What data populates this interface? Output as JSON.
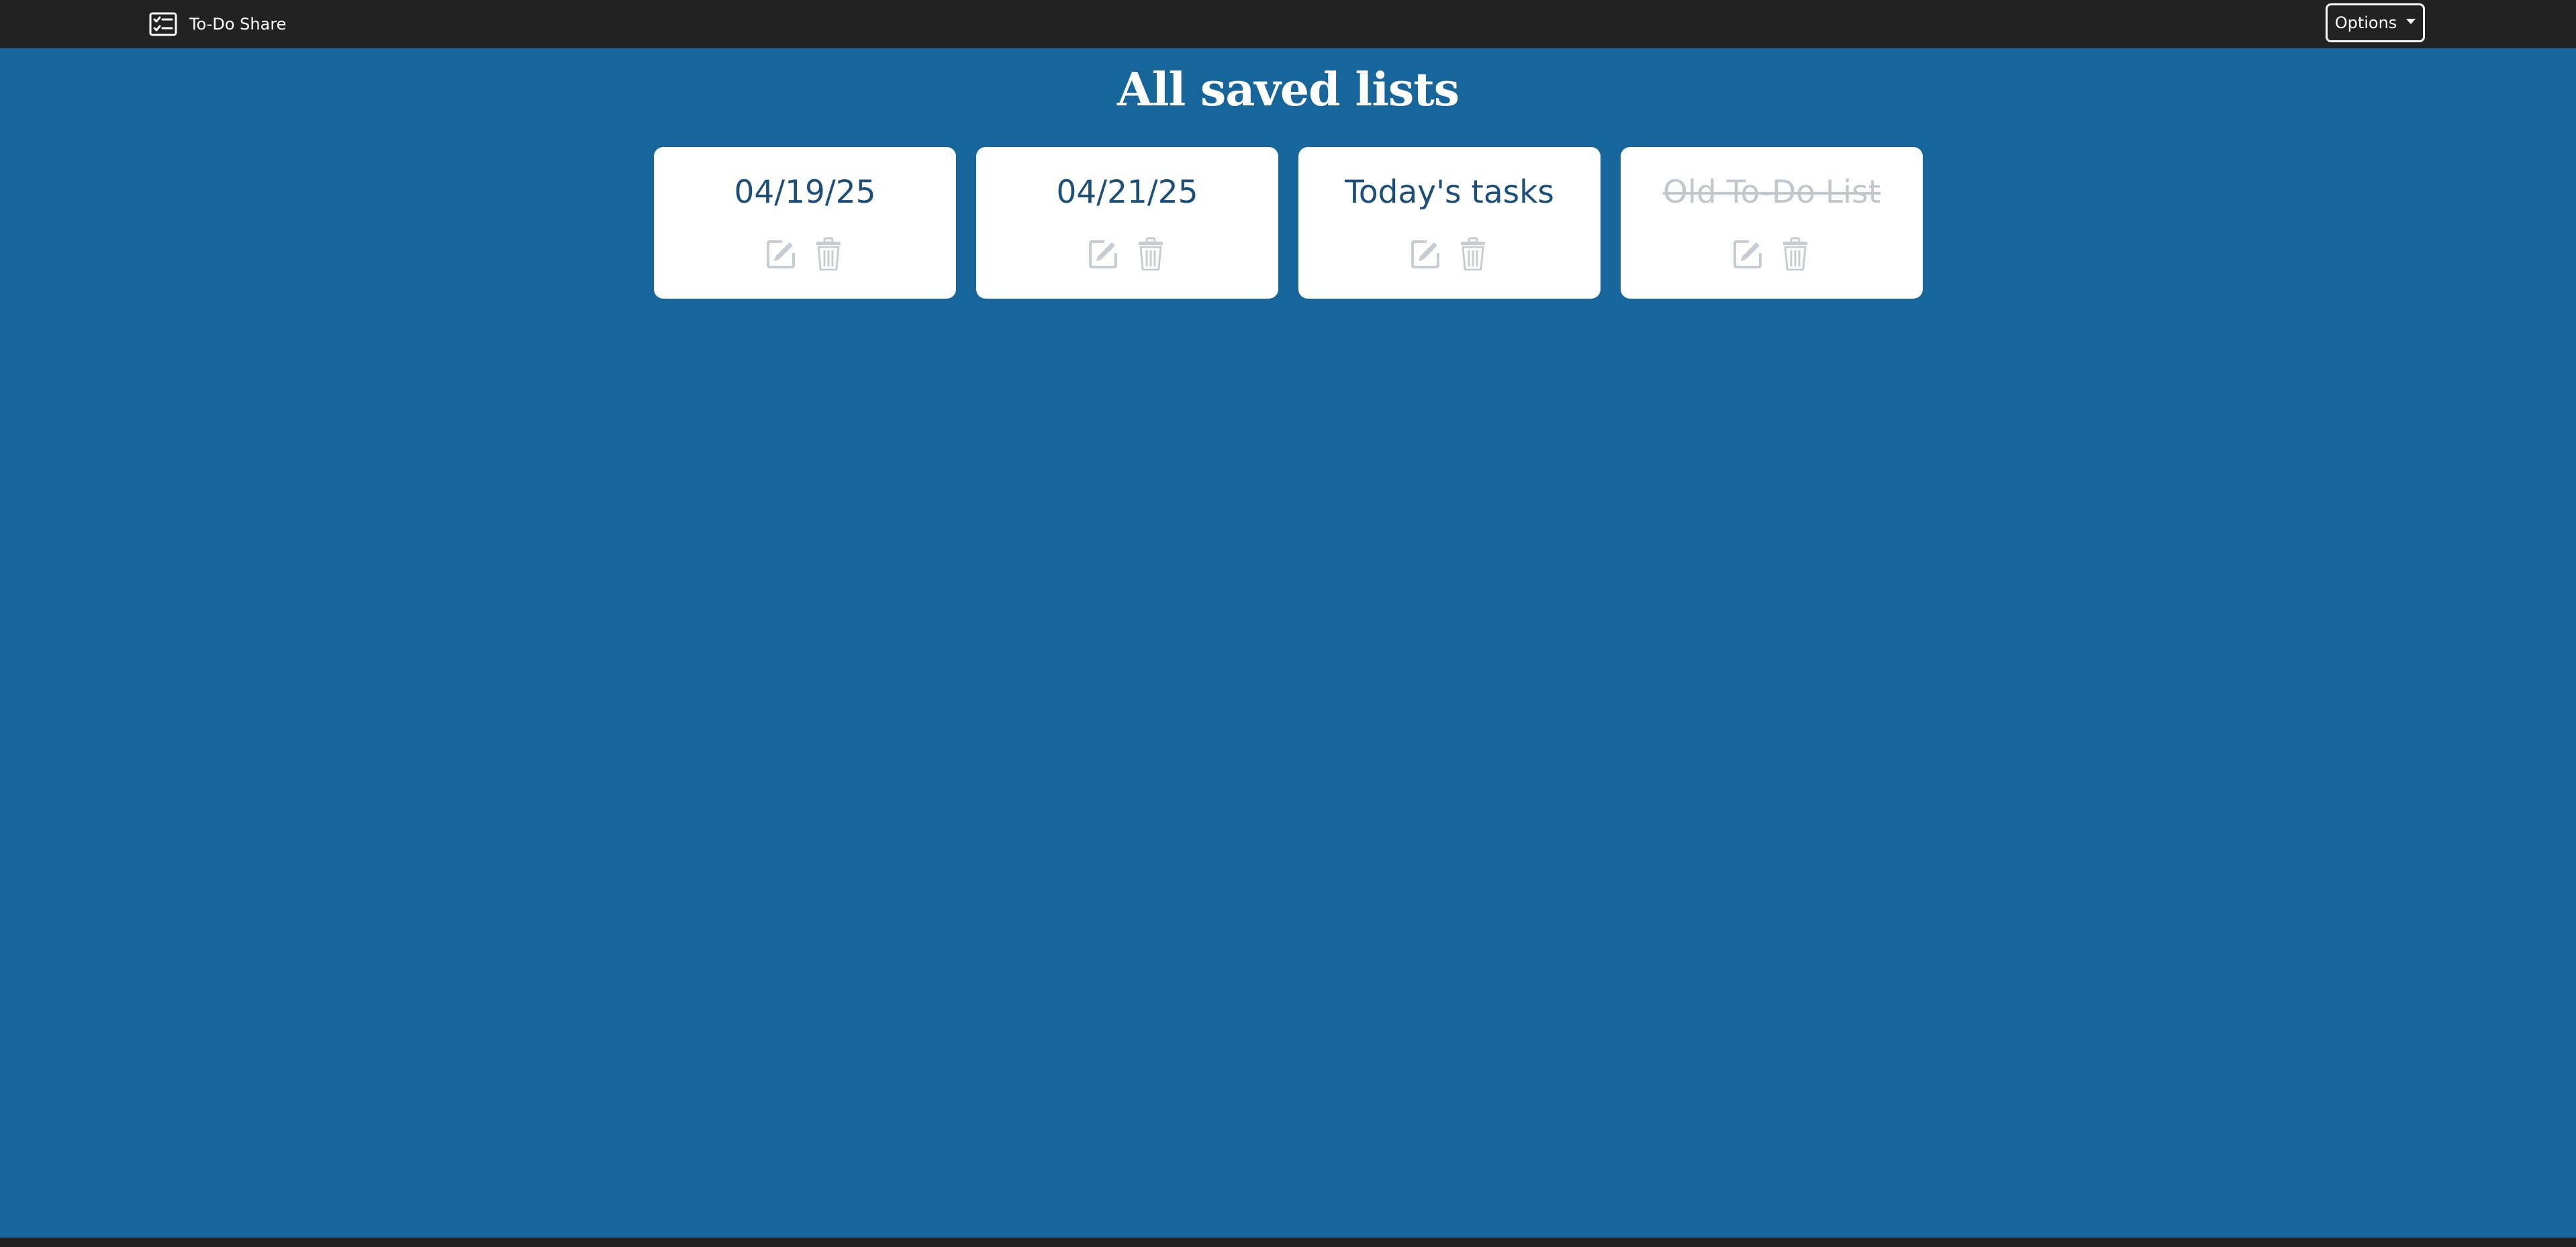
{
  "navbar": {
    "brand_icon": "checklist-icon",
    "brand_text": "To-Do Share",
    "options_label": "Options",
    "options_icon": "caret-down-icon"
  },
  "main": {
    "title": "All saved lists",
    "lists": [
      {
        "title": "04/19/25",
        "completed": false,
        "edit_icon": "edit-icon",
        "delete_icon": "trash-icon"
      },
      {
        "title": "04/21/25",
        "completed": false,
        "edit_icon": "edit-icon",
        "delete_icon": "trash-icon"
      },
      {
        "title": "Today's tasks",
        "completed": false,
        "edit_icon": "edit-icon",
        "delete_icon": "trash-icon"
      },
      {
        "title": "Old To-Do List",
        "completed": true,
        "edit_icon": "edit-icon",
        "delete_icon": "trash-icon"
      }
    ]
  },
  "colors": {
    "background": "#17669b",
    "navbar": "#222222",
    "card": "#ffffff",
    "card_title": "#1b4f7a",
    "completed_title": "#c2c7cc",
    "icon": "#c8cdd1"
  }
}
